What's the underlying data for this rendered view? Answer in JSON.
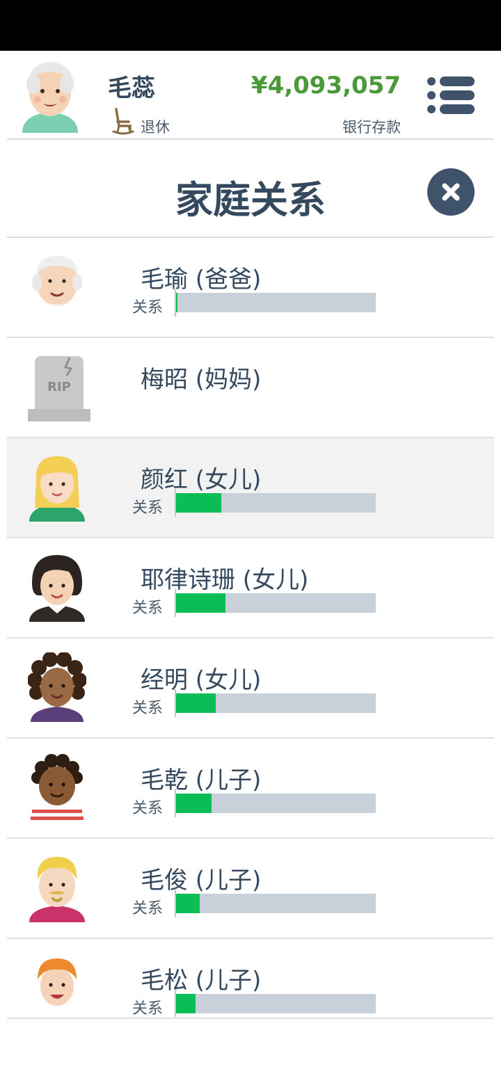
{
  "header": {
    "player_name": "毛蕊",
    "status": "退休",
    "money": "¥4,093,057",
    "money_label": "银行存款"
  },
  "page": {
    "title": "家庭关系"
  },
  "relation_label": "关系",
  "family": [
    {
      "name": "毛瑜 (爸爸)",
      "relationship": 0.01,
      "deceased": false,
      "avatar": "old-man-avatar"
    },
    {
      "name": "梅昭 (妈妈)",
      "relationship": null,
      "deceased": true,
      "avatar": "rip-gravestone-icon"
    },
    {
      "name": "颜红 (女儿)",
      "relationship": 0.23,
      "deceased": false,
      "avatar": "blonde-girl-avatar"
    },
    {
      "name": "耶律诗珊 (女儿)",
      "relationship": 0.25,
      "deceased": false,
      "avatar": "dark-hair-woman-avatar"
    },
    {
      "name": "经明 (女儿)",
      "relationship": 0.2,
      "deceased": false,
      "avatar": "curly-hair-woman-avatar"
    },
    {
      "name": "毛乾 (儿子)",
      "relationship": 0.18,
      "deceased": false,
      "avatar": "curly-hair-boy-avatar"
    },
    {
      "name": "毛俊 (儿子)",
      "relationship": 0.12,
      "deceased": false,
      "avatar": "blonde-man-avatar"
    },
    {
      "name": "毛松 (儿子)",
      "relationship": 0.1,
      "deceased": false,
      "avatar": "redhead-boy-avatar"
    }
  ],
  "colors": {
    "primary_text": "#34495e",
    "money": "#4a9a3a",
    "bar_fill": "#0bbd55",
    "bar_track": "#c8d0da",
    "close_button": "#3f536b"
  }
}
